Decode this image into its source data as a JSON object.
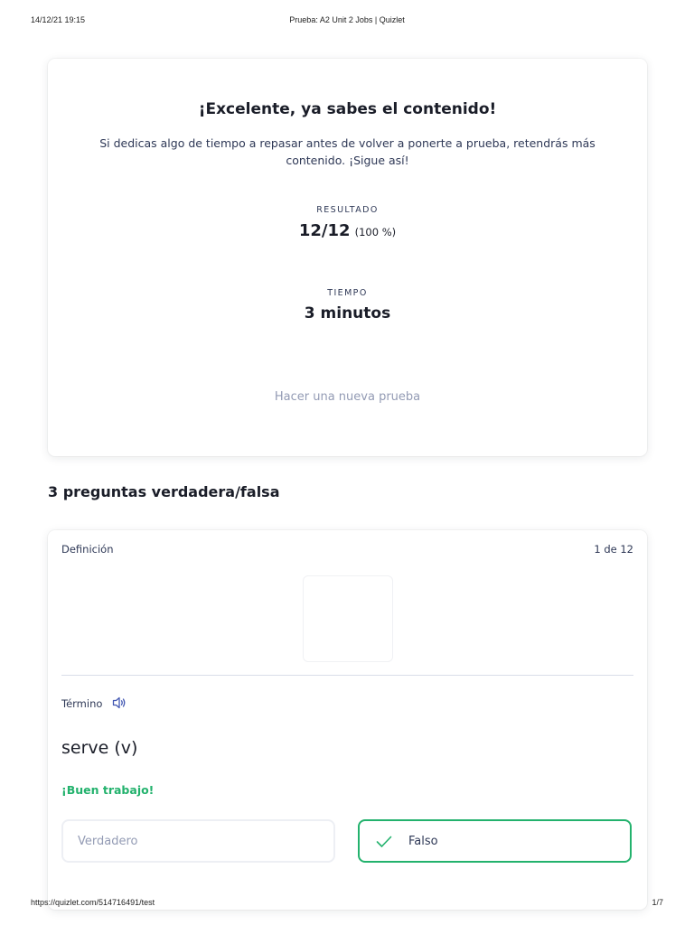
{
  "print": {
    "datetime": "14/12/21 19:15",
    "doc_title": "Prueba: A2 Unit 2 Jobs | Quizlet",
    "url": "https://quizlet.com/514716491/test",
    "page": "1/7"
  },
  "result": {
    "title": "¡Excelente, ya sabes el contenido!",
    "subtitle": "Si dedicas algo de tiempo a repasar antes de volver a ponerte a prueba, retendrás más contenido. ¡Sigue así!",
    "score_label": "RESULTADO",
    "score": "12/12",
    "score_percent": "(100 %)",
    "time_label": "TIEMPO",
    "time": "3 minutos",
    "retry_label": "Hacer una nueva prueba"
  },
  "section": {
    "title": "3 preguntas verdadera/falsa"
  },
  "question": {
    "definition_label": "Definición",
    "counter": "1 de 12",
    "term_label": "Término",
    "term": "serve (v)",
    "feedback": "¡Buen trabajo!",
    "option_true": "Verdadero",
    "option_false": "Falso",
    "selected": "Falso",
    "icons": {
      "audio": "speaker-icon",
      "check": "check-icon"
    }
  },
  "colors": {
    "success": "#23b26d",
    "muted": "#939bb4",
    "text": "#2e3856"
  }
}
